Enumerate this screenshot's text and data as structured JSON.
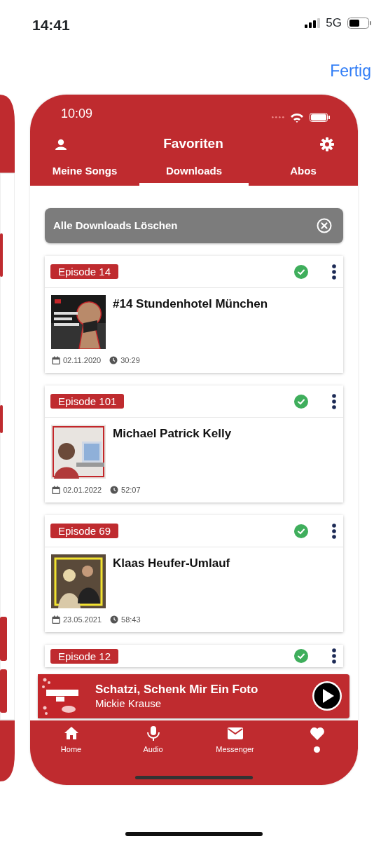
{
  "status_bar": {
    "time": "14:41",
    "network": "5G"
  },
  "done_button": "Fertig",
  "app": {
    "status_bar": {
      "time": "10:09"
    },
    "title": "Favoriten",
    "tabs": [
      {
        "label": "Meine Songs",
        "selected": false
      },
      {
        "label": "Downloads",
        "selected": true
      },
      {
        "label": "Abos",
        "selected": false
      }
    ],
    "delete_all_button": "Alle Downloads Löschen",
    "episodes": [
      {
        "badge": "Episode 14",
        "downloaded": true,
        "title": "#14 Stundenhotel München",
        "date": "02.11.2020",
        "duration": "30:29"
      },
      {
        "badge": "Episode 101",
        "downloaded": true,
        "title": "Michael Patrick Kelly",
        "date": "02.01.2022",
        "duration": "52:07"
      },
      {
        "badge": "Episode 69",
        "downloaded": true,
        "title": "Klaas Heufer-Umlauf",
        "date": "23.05.2021",
        "duration": "58:43"
      },
      {
        "badge": "Episode 12",
        "downloaded": true
      }
    ],
    "player": {
      "title": "Schatzi, Schenk Mir Ein Foto",
      "artist": "Mickie Krause"
    },
    "nav": [
      {
        "kind": "home",
        "label": "Home",
        "selected": false
      },
      {
        "kind": "mic",
        "label": "Audio",
        "selected": false
      },
      {
        "kind": "mail",
        "label": "Messenger",
        "selected": false
      },
      {
        "kind": "heart",
        "selected": true
      }
    ]
  }
}
